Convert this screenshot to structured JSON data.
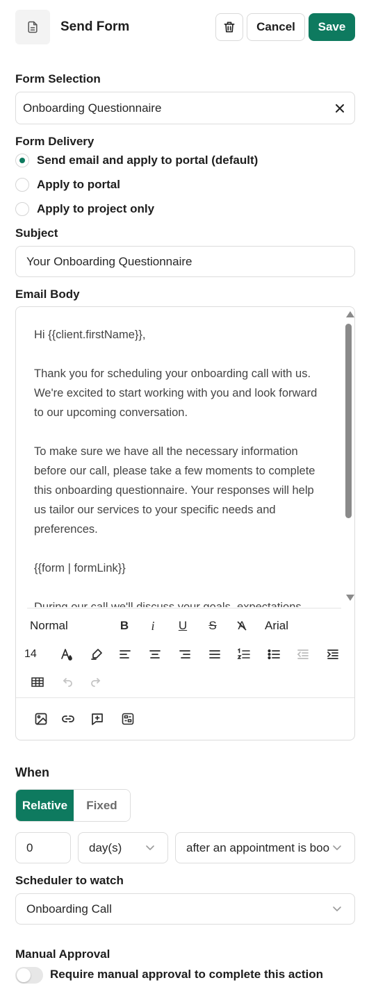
{
  "header": {
    "title": "Send Form",
    "cancel_label": "Cancel",
    "save_label": "Save"
  },
  "form_selection": {
    "label": "Form Selection",
    "value": "Onboarding Questionnaire"
  },
  "form_delivery": {
    "label": "Form Delivery",
    "options": [
      {
        "label": "Send email and apply to portal (default)",
        "checked": true
      },
      {
        "label": "Apply to portal",
        "checked": false
      },
      {
        "label": "Apply to project only",
        "checked": false
      }
    ]
  },
  "subject": {
    "label": "Subject",
    "value": "Your Onboarding Questionnaire"
  },
  "email_body": {
    "label": "Email Body",
    "paragraphs": [
      "Hi {{client.firstName}},",
      "Thank you for scheduling your onboarding call with us. We're excited to start working with you and look forward to our upcoming conversation.",
      "To make sure we have all the necessary information before our call, please take a few moments to complete this onboarding questionnaire. Your responses will help us tailor our services to your specific needs and preferences.",
      "{{form | formLink}}",
      "During our call we'll discuss your goals, expectations"
    ],
    "toolbar": {
      "style": "Normal",
      "bold": "B",
      "italic": "i",
      "underline": "U",
      "strike": "S",
      "clear": "A",
      "font": "Arial",
      "size": "14"
    }
  },
  "when": {
    "label": "When",
    "tabs": [
      "Relative",
      "Fixed"
    ],
    "amount": "0",
    "unit": "day(s)",
    "trigger": "after an appointment is booked"
  },
  "scheduler": {
    "label": "Scheduler to watch",
    "value": "Onboarding Call"
  },
  "manual_approval": {
    "label": "Manual Approval",
    "toggle_label": "Require manual approval to complete this action",
    "enabled": false
  },
  "colors": {
    "accent": "#0e7a5f",
    "border": "#dcdcdc"
  }
}
